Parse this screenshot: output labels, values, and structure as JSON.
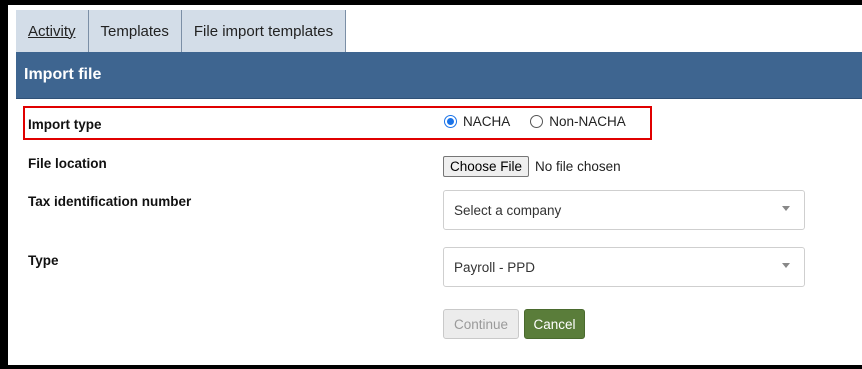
{
  "tabs": [
    {
      "label": "Activity"
    },
    {
      "label": "Templates"
    },
    {
      "label": "File import templates"
    }
  ],
  "panel": {
    "title": "Import file"
  },
  "form": {
    "import_type": {
      "label": "Import type",
      "options": [
        {
          "label": "NACHA",
          "selected": true
        },
        {
          "label": "Non-NACHA",
          "selected": false
        }
      ]
    },
    "file_location": {
      "label": "File location",
      "button": "Choose File",
      "status": "No file chosen"
    },
    "tax_id": {
      "label": "Tax identification number",
      "value": "Select a company"
    },
    "type": {
      "label": "Type",
      "value": "Payroll - PPD"
    }
  },
  "actions": {
    "continue": "Continue",
    "cancel": "Cancel"
  },
  "colors": {
    "header": "#3e6590",
    "tab_bg": "#d3dde8",
    "highlight": "#e00000",
    "cancel_btn": "#5a7d3a"
  }
}
